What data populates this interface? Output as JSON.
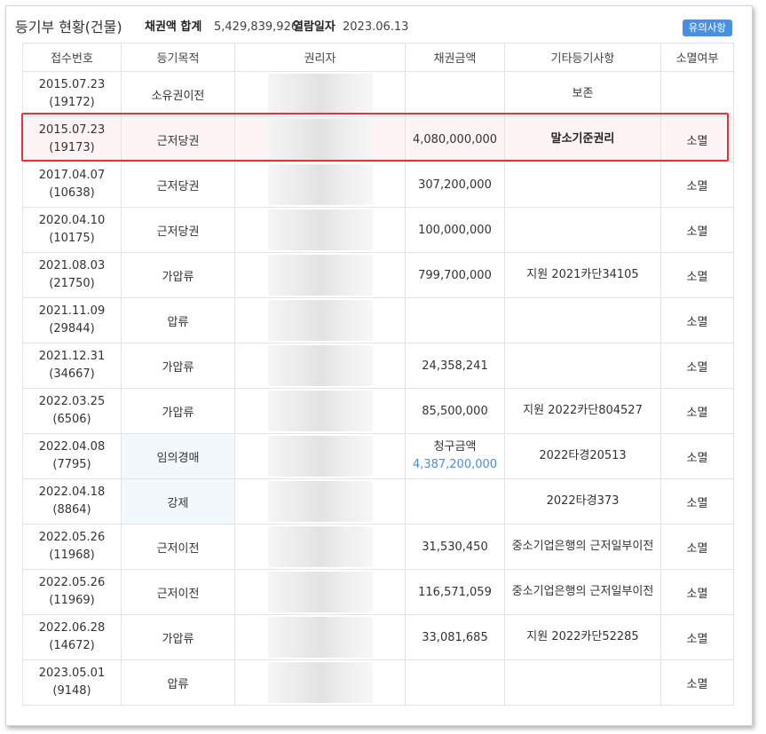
{
  "header": {
    "title": "등기부 현황(건물)",
    "sum_label": "채권액 합계",
    "sum_value": "5,429,839,926",
    "date_label": "열람일자",
    "date_value": "2023.06.13",
    "notice_button": "유의사항"
  },
  "columns": [
    "접수번호",
    "등기목적",
    "권리자",
    "채권금액",
    "기타등기사항",
    "소멸여부"
  ],
  "rows": [
    {
      "date": "2015.07.23",
      "receipt": "(19172)",
      "purpose": "소유권이전",
      "amount": "",
      "amount_label": "",
      "etc": "보존",
      "status": ""
    },
    {
      "date": "2015.07.23",
      "receipt": "(19173)",
      "purpose": "근저당권",
      "amount": "4,080,000,000",
      "amount_label": "",
      "etc": "말소기준권리",
      "status": "소멸"
    },
    {
      "date": "2017.04.07",
      "receipt": "(10638)",
      "purpose": "근저당권",
      "amount": "307,200,000",
      "amount_label": "",
      "etc": "",
      "status": "소멸"
    },
    {
      "date": "2020.04.10",
      "receipt": "(10175)",
      "purpose": "근저당권",
      "amount": "100,000,000",
      "amount_label": "",
      "etc": "",
      "status": "소멸"
    },
    {
      "date": "2021.08.03",
      "receipt": "(21750)",
      "purpose": "가압류",
      "amount": "799,700,000",
      "amount_label": "",
      "etc": "지원 2021카단34105",
      "status": "소멸"
    },
    {
      "date": "2021.11.09",
      "receipt": "(29844)",
      "purpose": "압류",
      "amount": "",
      "amount_label": "",
      "etc": "",
      "status": "소멸"
    },
    {
      "date": "2021.12.31",
      "receipt": "(34667)",
      "purpose": "가압류",
      "amount": "24,358,241",
      "amount_label": "",
      "etc": "",
      "status": "소멸"
    },
    {
      "date": "2022.03.25",
      "receipt": "(6506)",
      "purpose": "가압류",
      "amount": "85,500,000",
      "amount_label": "",
      "etc": "지원 2022카단804527",
      "status": "소멸"
    },
    {
      "date": "2022.04.08",
      "receipt": "(7795)",
      "purpose": "임의경매",
      "amount": "4,387,200,000",
      "amount_label": "청구금액",
      "etc": "2022타경20513",
      "status": "소멸"
    },
    {
      "date": "2022.04.18",
      "receipt": "(8864)",
      "purpose": "강제",
      "amount": "",
      "amount_label": "",
      "etc": "2022타경373",
      "status": "소멸"
    },
    {
      "date": "2022.05.26",
      "receipt": "(11968)",
      "purpose": "근저이전",
      "amount": "31,530,450",
      "amount_label": "",
      "etc": "중소기업은행의 근저일부이전",
      "status": "소멸"
    },
    {
      "date": "2022.05.26",
      "receipt": "(11969)",
      "purpose": "근저이전",
      "amount": "116,571,059",
      "amount_label": "",
      "etc": "중소기업은행의 근저일부이전",
      "status": "소멸"
    },
    {
      "date": "2022.06.28",
      "receipt": "(14672)",
      "purpose": "가압류",
      "amount": "33,081,685",
      "amount_label": "",
      "etc": "지원 2022카단52285",
      "status": "소멸"
    },
    {
      "date": "2023.05.01",
      "receipt": "(9148)",
      "purpose": "압류",
      "amount": "",
      "amount_label": "",
      "etc": "",
      "status": "소멸"
    }
  ],
  "colors": {
    "accent": "#4a90e2",
    "highlight_border": "#e8323a",
    "link_blue": "#4a90d9",
    "auction_cell_bg": "#f3f8fd"
  }
}
